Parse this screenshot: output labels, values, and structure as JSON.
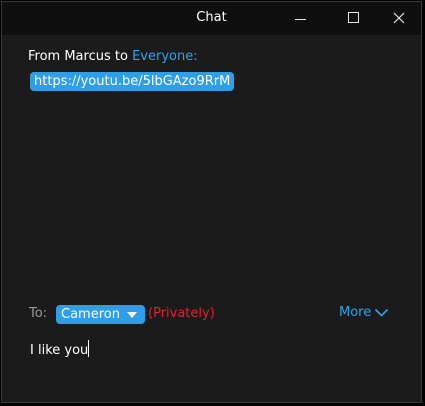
{
  "window": {
    "title": "Chat",
    "controls": {
      "minimize": "minimize-icon",
      "maximize": "maximize-icon",
      "close": "close-icon"
    }
  },
  "message": {
    "from_prefix": "From Marcus to ",
    "recipient": "Everyone:",
    "link": "https://youtu.be/5lbGAzo9RrM"
  },
  "composer": {
    "to_label": "To:",
    "selected_recipient": "Cameron",
    "privacy_note": "(Privately)",
    "more_label": "More",
    "input_value": "I like you"
  },
  "colors": {
    "accent": "#2e9fe6",
    "link_text": "#2ea3ee",
    "private_red": "#e0242c",
    "background": "#1b1b1b",
    "titlebar": "#0f0f0f"
  }
}
